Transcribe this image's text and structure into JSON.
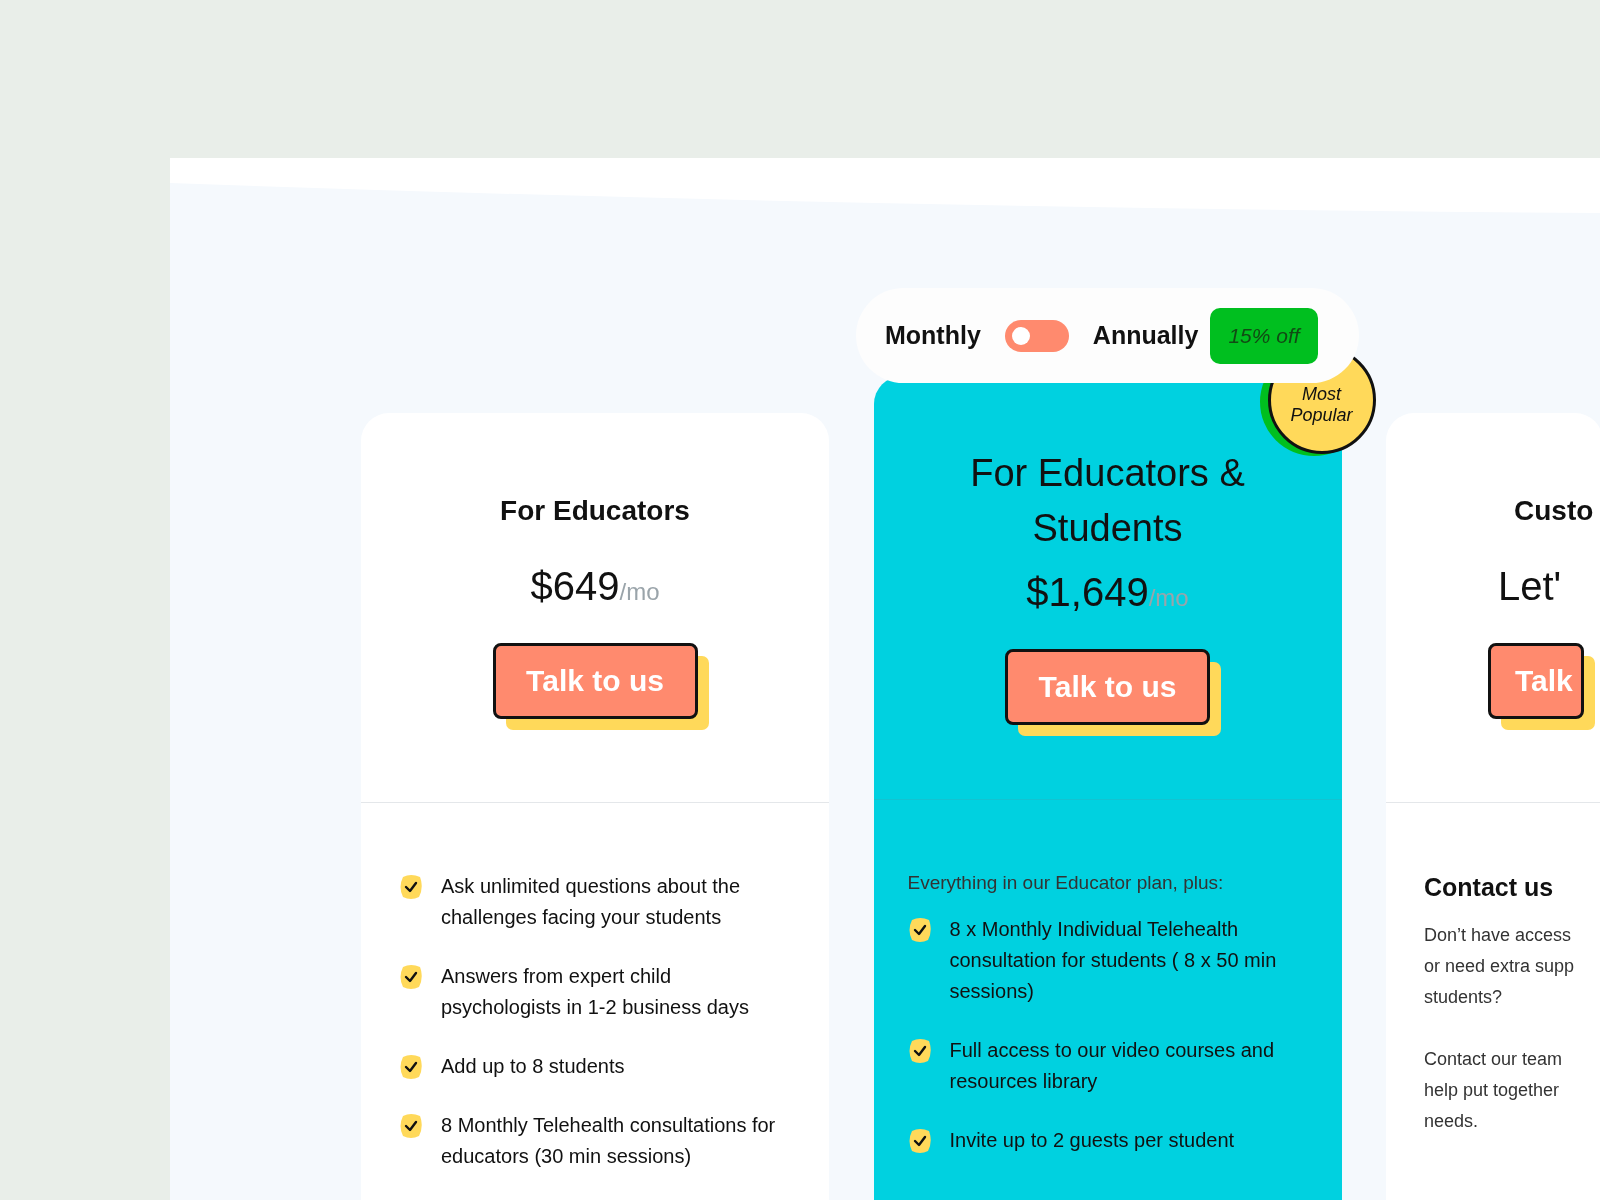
{
  "billing_toggle": {
    "monthly_label": "Monthly",
    "annual_label": "Annually",
    "annual": false,
    "discount_badge": "15% off"
  },
  "plans": [
    {
      "title": "For Educators",
      "price": "$649",
      "period": "/mo",
      "button": "Talk to us",
      "featured": false,
      "features": [
        "Ask unlimited questions about the challenges facing your students",
        "Answers from expert child psychologists in 1-2 business days",
        "Add up to 8 students",
        "8 Monthly Telehealth consultations for educators  (30 min sessions)"
      ]
    },
    {
      "title": "For Educators & Students",
      "price": "$1,649",
      "period": "/mo",
      "button": "Talk to us",
      "featured": true,
      "ribbon": "Most Popular",
      "intro": "Everything in our Educator plan, plus:",
      "features": [
        "8 x Monthly Individual Telehealth consultation for students ( 8 x 50 min sessions)",
        "Full access to our video courses and resources library",
        "Invite up to 2 guests per student"
      ]
    },
    {
      "title": "Custo",
      "price": "Let'",
      "button": "Talk",
      "featured": false,
      "contact_heading": "Contact us",
      "contact_paragraphs": [
        [
          "Don’t have access",
          "or need extra supp",
          "students?"
        ],
        [
          "Contact our team",
          "help put together",
          "needs."
        ]
      ]
    }
  ]
}
